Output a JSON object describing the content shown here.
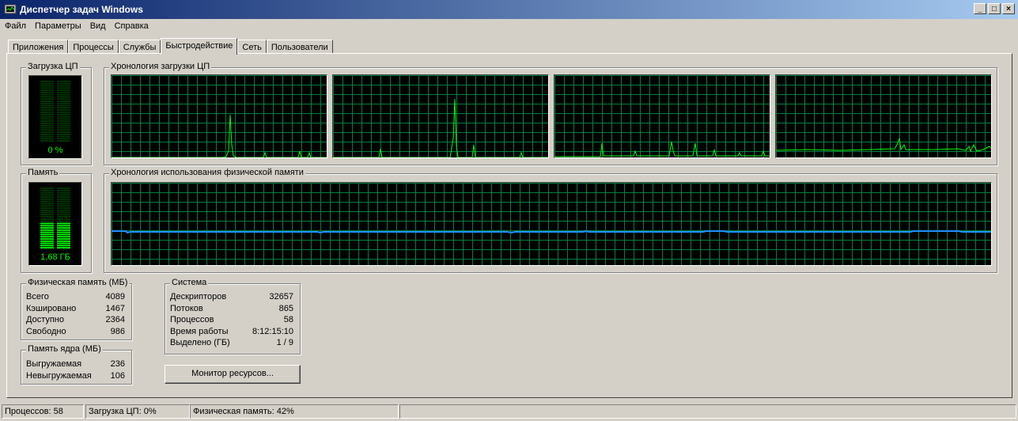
{
  "window": {
    "title": "Диспетчер задач Windows",
    "min": "_",
    "max": "□",
    "close": "×"
  },
  "menu": [
    "Файл",
    "Параметры",
    "Вид",
    "Справка"
  ],
  "tabs": [
    "Приложения",
    "Процессы",
    "Службы",
    "Быстродействие",
    "Сеть",
    "Пользователи"
  ],
  "cpu": {
    "label": "Загрузка ЦП",
    "value": "0 %",
    "level": 0.0
  },
  "cpu_history": {
    "label": "Хронология загрузки ЦП"
  },
  "memory": {
    "label": "Память",
    "value": "1,68 ГБ",
    "level": 0.42
  },
  "memory_history": {
    "label": "Хронология использования физической памяти"
  },
  "physical_memory": {
    "label": "Физическая память (МБ)",
    "rows": [
      {
        "k": "Всего",
        "v": "4089"
      },
      {
        "k": "Кэшировано",
        "v": "1467"
      },
      {
        "k": "Доступно",
        "v": "2364"
      },
      {
        "k": "Свободно",
        "v": "986"
      }
    ]
  },
  "kernel_memory": {
    "label": "Память ядра (МБ)",
    "rows": [
      {
        "k": "Выгружаемая",
        "v": "236"
      },
      {
        "k": "Невыгружаемая",
        "v": "106"
      }
    ]
  },
  "system": {
    "label": "Система",
    "rows": [
      {
        "k": "Дескрипторов",
        "v": "32657"
      },
      {
        "k": "Потоков",
        "v": "865"
      },
      {
        "k": "Процессов",
        "v": "58"
      },
      {
        "k": "Время работы",
        "v": "8:12:15:10"
      },
      {
        "k": "Выделено (ГБ)",
        "v": "1 / 9"
      }
    ]
  },
  "resource_monitor_button": "Монитор ресурсов...",
  "status": {
    "processes": "Процессов: 58",
    "cpu": "Загрузка ЦП: 0%",
    "memory": "Физическая память: 42%"
  },
  "colors": {
    "graph_green": "#00ff00",
    "grid": "#008040",
    "memory_line": "#1e90ff"
  }
}
